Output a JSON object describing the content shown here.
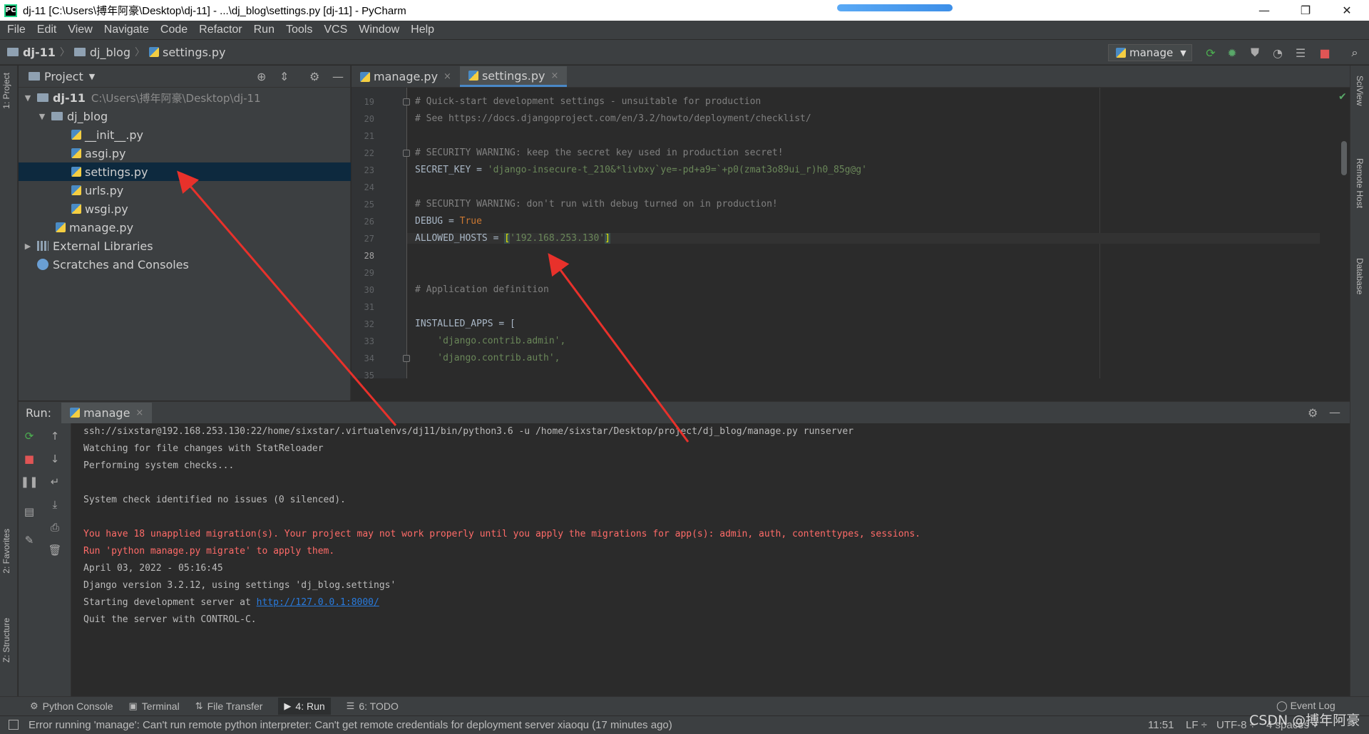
{
  "window": {
    "title": "dj-11 [C:\\Users\\搏年阿豪\\Desktop\\dj-11] - ...\\dj_blog\\settings.py [dj-11] - PyCharm",
    "app_icon": "PC",
    "minimize": "—",
    "restore": "❐",
    "close": "✕"
  },
  "menu": [
    "File",
    "Edit",
    "View",
    "Navigate",
    "Code",
    "Refactor",
    "Run",
    "Tools",
    "VCS",
    "Window",
    "Help"
  ],
  "breadcrumb": {
    "project": "dj-11",
    "folder": "dj_blog",
    "file": "settings.py"
  },
  "run_config": {
    "name": "manage"
  },
  "project_panel": {
    "title": "Project",
    "tree": [
      {
        "label": "dj-11",
        "path": "C:\\Users\\搏年阿豪\\Desktop\\dj-11",
        "toggle": "▼"
      },
      {
        "label": "dj_blog",
        "toggle": "▼"
      },
      {
        "label": "__init__.py"
      },
      {
        "label": "asgi.py"
      },
      {
        "label": "settings.py"
      },
      {
        "label": "urls.py"
      },
      {
        "label": "wsgi.py"
      },
      {
        "label": "manage.py"
      },
      {
        "label": "External Libraries",
        "toggle": "▶"
      },
      {
        "label": "Scratches and Consoles"
      }
    ]
  },
  "side_tabs": {
    "left": [
      "1: Project",
      "2: Favorites",
      "Z: Structure"
    ],
    "right": [
      "SciView",
      "Remote Host",
      "Database"
    ]
  },
  "editor": {
    "tabs": [
      {
        "label": "manage.py",
        "close": "×"
      },
      {
        "label": "settings.py",
        "close": "×"
      }
    ],
    "line_numbers": [
      "19",
      "20",
      "21",
      "22",
      "23",
      "24",
      "25",
      "26",
      "27",
      "28",
      "29",
      "30",
      "31",
      "32",
      "33",
      "34",
      "35"
    ],
    "current_line": "28",
    "lines": {
      "l19": "# Quick-start development settings - unsuitable for production",
      "l20": "# See https://docs.djangoproject.com/en/3.2/howto/deployment/checklist/",
      "l22": "# SECURITY WARNING: keep the secret key used in production secret!",
      "l23_key": "SECRET_KEY = ",
      "l23_val": "'django-insecure-t_210&*livbxy`ye=-pd+a9=`+p0(zmat3o89ui_r)h0_85g@g'",
      "l25": "# SECURITY WARNING: don't run with debug turned on in production!",
      "l26_key": "DEBUG = ",
      "l26_val": "True",
      "l28_key": "ALLOWED_HOSTS = ",
      "l28_open": "[",
      "l28_val": "'192.168.253.130'",
      "l28_close": "]",
      "l31": "# Application definition",
      "l33": "INSTALLED_APPS = [",
      "l34": "    'django.contrib.admin',",
      "l35": "    'django.contrib.auth',"
    }
  },
  "run_panel": {
    "label": "Run:",
    "tab": "manage",
    "tab_close": "×",
    "console": [
      "ssh://sixstar@192.168.253.130:22/home/sixstar/.virtualenvs/dj11/bin/python3.6 -u /home/sixstar/Desktop/project/dj_blog/manage.py runserver",
      "Watching for file changes with StatReloader",
      "Performing system checks...",
      "System check identified no issues (0 silenced).",
      "You have 18 unapplied migration(s). Your project may not work properly until you apply the migrations for app(s): admin, auth, contenttypes, sessions.",
      "Run 'python manage.py migrate' to apply them.",
      "April 03, 2022 - 05:16:45",
      "Django version 3.2.12, using settings 'dj_blog.settings'",
      "Starting development server at ",
      "Quit the server with CONTROL-C."
    ],
    "server_link": "http://127.0.0.1:8000/"
  },
  "bottom_tabs": [
    "Python Console",
    "Terminal",
    "File Transfer",
    "4: Run",
    "6: TODO"
  ],
  "event_log": "Event Log",
  "status": {
    "message": "Error running 'manage': Can't run remote python interpreter: Can't get remote credentials for deployment server xiaoqu (17 minutes ago)",
    "time": "11:51",
    "line_sep": "LF ÷",
    "encoding": "UTF-8 ÷",
    "indent": "4 spaces ÷"
  },
  "watermark": "CSDN @搏年阿豪",
  "colors": {
    "annotation_arrow": "#e8312b",
    "accent": "#4a88c7",
    "error_text": "#ff6b68",
    "link": "#287bde"
  }
}
